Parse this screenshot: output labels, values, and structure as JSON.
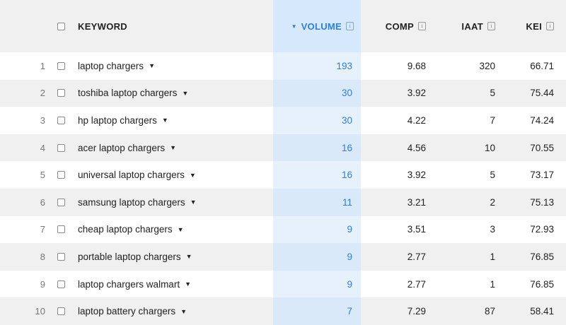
{
  "header": {
    "keyword": "KEYWORD",
    "volume": "VOLUME",
    "comp": "COMP",
    "iaat": "IAAT",
    "kei": "KEI",
    "info_glyph": "i",
    "sort_icon": "sort-desc-icon"
  },
  "rows": [
    {
      "num": "1",
      "keyword": "laptop chargers",
      "volume": "193",
      "comp": "9.68",
      "iaat": "320",
      "kei": "66.71"
    },
    {
      "num": "2",
      "keyword": "toshiba laptop chargers",
      "volume": "30",
      "comp": "3.92",
      "iaat": "5",
      "kei": "75.44"
    },
    {
      "num": "3",
      "keyword": "hp laptop chargers",
      "volume": "30",
      "comp": "4.22",
      "iaat": "7",
      "kei": "74.24"
    },
    {
      "num": "4",
      "keyword": "acer laptop chargers",
      "volume": "16",
      "comp": "4.56",
      "iaat": "10",
      "kei": "70.55"
    },
    {
      "num": "5",
      "keyword": "universal laptop chargers",
      "volume": "16",
      "comp": "3.92",
      "iaat": "5",
      "kei": "73.17"
    },
    {
      "num": "6",
      "keyword": "samsung laptop chargers",
      "volume": "11",
      "comp": "3.21",
      "iaat": "2",
      "kei": "75.13"
    },
    {
      "num": "7",
      "keyword": "cheap laptop chargers",
      "volume": "9",
      "comp": "3.51",
      "iaat": "3",
      "kei": "72.93"
    },
    {
      "num": "8",
      "keyword": "portable laptop chargers",
      "volume": "9",
      "comp": "2.77",
      "iaat": "1",
      "kei": "76.85"
    },
    {
      "num": "9",
      "keyword": "laptop chargers walmart",
      "volume": "9",
      "comp": "2.77",
      "iaat": "1",
      "kei": "76.85"
    },
    {
      "num": "10",
      "keyword": "laptop battery chargers",
      "volume": "7",
      "comp": "7.29",
      "iaat": "87",
      "kei": "58.41"
    }
  ],
  "colors": {
    "accent": "#2f7fd3",
    "header_bg": "#f0f0f0",
    "volume_col_bg": "#e6f1fc",
    "volume_header_bg": "#d6e8fb"
  }
}
